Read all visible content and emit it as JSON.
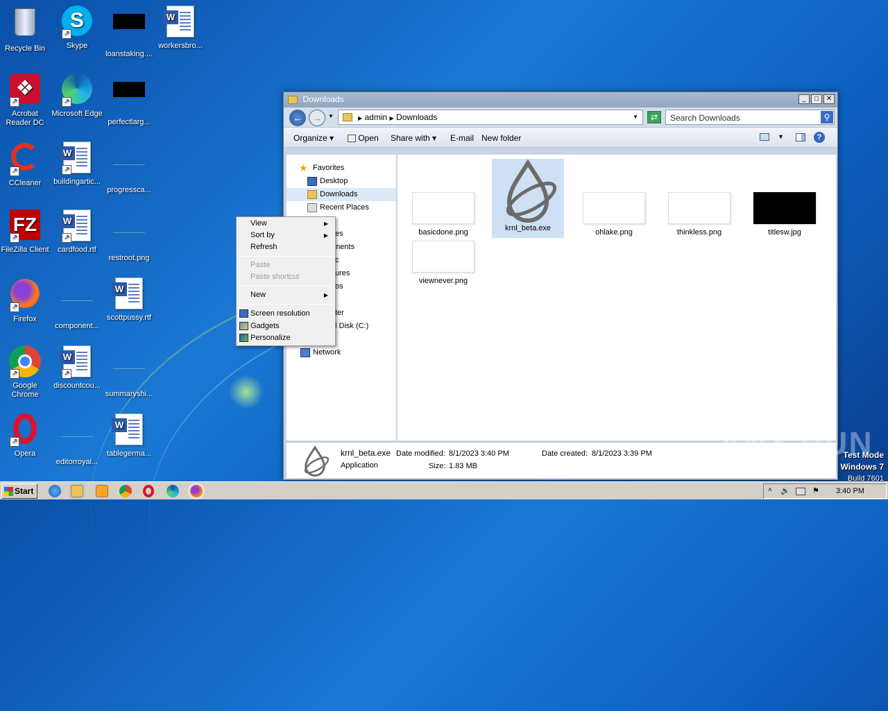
{
  "desktop": {
    "icons": [
      {
        "label": "Recycle Bin"
      },
      {
        "label": "Skype"
      },
      {
        "label": "loanstaking...."
      },
      {
        "label": "workersbro..."
      },
      {
        "label": "Acrobat Reader DC"
      },
      {
        "label": "Microsoft Edge"
      },
      {
        "label": "perfectlarg..."
      },
      {
        "label": "CCleaner"
      },
      {
        "label": "buildingartic..."
      },
      {
        "label": "progressca..."
      },
      {
        "label": "FileZilla Client"
      },
      {
        "label": "cardfood.rtf"
      },
      {
        "label": "restroot.png"
      },
      {
        "label": "Firefox"
      },
      {
        "label": "component..."
      },
      {
        "label": "scottpussy.rtf"
      },
      {
        "label": "Google Chrome"
      },
      {
        "label": "discountcou..."
      },
      {
        "label": "summaryshi..."
      },
      {
        "label": "Opera"
      },
      {
        "label": "editorroyal..."
      },
      {
        "label": "tablegerma..."
      }
    ]
  },
  "explorer": {
    "title": "Downloads",
    "address": {
      "crumb1": "admin",
      "crumb2": "Downloads"
    },
    "search_placeholder": "Search Downloads",
    "toolbar": {
      "organize": "Organize",
      "open": "Open",
      "share": "Share with",
      "email": "E-mail",
      "new_folder": "New folder"
    },
    "nav": {
      "favorites": "Favorites",
      "desktop": "Desktop",
      "downloads": "Downloads",
      "recent": "Recent Places",
      "libraries_tail": "es",
      "documents_tail": "uments",
      "music_tail": "c",
      "pictures_tail": "ures",
      "videos_tail": "os",
      "computer_tail": "ter",
      "disk_tail": "l Disk (C:)",
      "network": "Network"
    },
    "files": [
      {
        "name": "basicdone.png"
      },
      {
        "name": "krnl_beta.exe"
      },
      {
        "name": "ohlake.png"
      },
      {
        "name": "thinkless.png"
      },
      {
        "name": "titlesw.jpg"
      },
      {
        "name": "viewnever.png"
      }
    ],
    "details": {
      "name": "krnl_beta.exe",
      "type": "Application",
      "modified_label": "Date modified:",
      "modified": "8/1/2023 3:40 PM",
      "created_label": "Date created:",
      "created": "8/1/2023 3:39 PM",
      "size_label": "Size:",
      "size": "1.83 MB"
    }
  },
  "context_menu": {
    "view": "View",
    "sort_by": "Sort by",
    "refresh": "Refresh",
    "paste": "Paste",
    "paste_shortcut": "Paste shortcut",
    "new": "New",
    "screen_resolution": "Screen resolution",
    "gadgets": "Gadgets",
    "personalize": "Personalize"
  },
  "taskbar": {
    "start": "Start",
    "clock": "3:40 PM"
  },
  "watermark": "ANY RUN",
  "winver": {
    "line1": "Test Mode",
    "line2": "Windows 7",
    "line3": "Build 7601"
  }
}
